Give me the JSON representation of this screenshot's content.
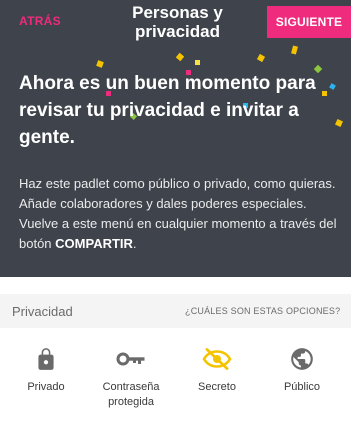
{
  "header": {
    "back_label": "ATRÁS",
    "title": "Personas y privacidad",
    "next_label": "SIGUIENTE"
  },
  "intro": {
    "headline": "Ahora es un buen momento para revisar tu privacidad e invitar a gente.",
    "description_prefix": "Haz este padlet como público o privado, como quieras. Añade colaboradores y dales poderes especiales. Vuelve a este menú en cualquier momento a través del botón ",
    "description_button": "COMPARTIR",
    "description_suffix": "."
  },
  "privacy": {
    "section_label": "Privacidad",
    "help_link": "¿CUÁLES SON ESTAS OPCIONES?",
    "options": [
      {
        "label": "Privado",
        "icon": "lock-icon",
        "selected": false
      },
      {
        "label": "Contraseña protegida",
        "icon": "key-icon",
        "selected": false
      },
      {
        "label": "Secreto",
        "icon": "eye-slash-icon",
        "selected": true
      },
      {
        "label": "Público",
        "icon": "globe-icon",
        "selected": false
      }
    ]
  },
  "colors": {
    "accent_pink": "#ee2b7c",
    "dark_bg": "#3f434b",
    "selected_yellow": "#f5c400",
    "icon_gray": "#6a6a6a",
    "confetti": [
      "#f5c400",
      "#8dc63f",
      "#ee2b7c",
      "#2bb3ee",
      "#f7e14b"
    ]
  }
}
